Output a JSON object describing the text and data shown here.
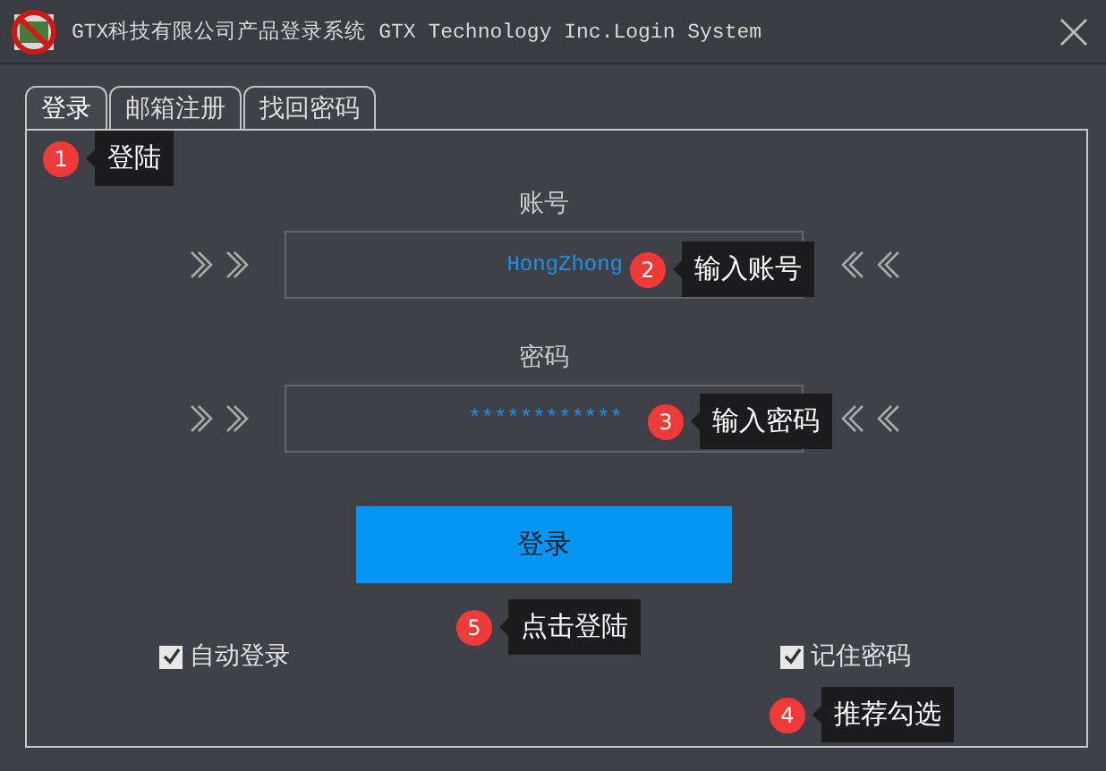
{
  "window": {
    "title": "GTX科技有限公司产品登录系统 GTX Technology Inc.Login System"
  },
  "tabs": [
    {
      "label": "登录",
      "selected": true
    },
    {
      "label": "邮箱注册",
      "selected": false
    },
    {
      "label": "找回密码",
      "selected": false
    }
  ],
  "account": {
    "label": "账号",
    "value": "HongZhong"
  },
  "password": {
    "label": "密码",
    "value": "************"
  },
  "login_button": "登录",
  "checkboxes": [
    {
      "label": "自动登录",
      "checked": true
    },
    {
      "label": "记住密码",
      "checked": true
    }
  ],
  "annotations": [
    {
      "number": "1",
      "text": "登陆"
    },
    {
      "number": "2",
      "text": "输入账号"
    },
    {
      "number": "3",
      "text": "输入密码"
    },
    {
      "number": "4",
      "text": "推荐勾选"
    },
    {
      "number": "5",
      "text": "点击登陆"
    }
  ]
}
